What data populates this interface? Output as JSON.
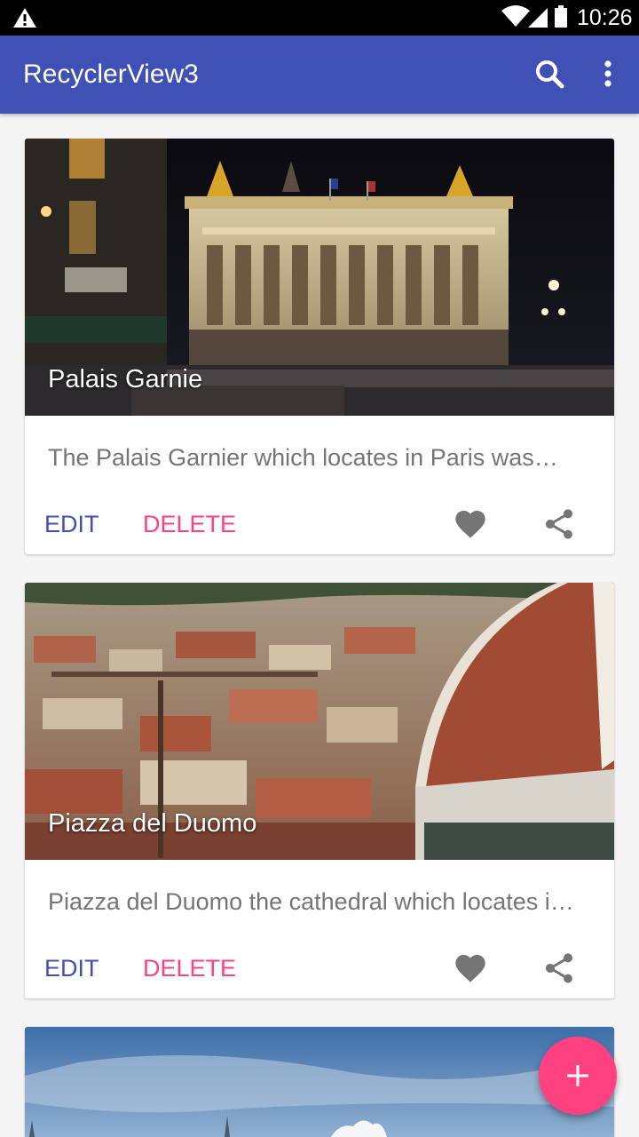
{
  "status_bar": {
    "time": "10:26",
    "icons": [
      "warning-icon",
      "wifi-icon",
      "signal-icon",
      "battery-icon"
    ]
  },
  "app_bar": {
    "title": "RecyclerView3",
    "actions": [
      "search-icon",
      "more-vert-icon"
    ],
    "color": "#3f51b5"
  },
  "cards": [
    {
      "title": "Palais Garnie",
      "description": "The Palais Garnier which locates in Paris was…",
      "edit_label": "EDIT",
      "delete_label": "DELETE",
      "actions": [
        "favorite-icon",
        "share-icon"
      ]
    },
    {
      "title": "Piazza del Duomo",
      "description": "Piazza del Duomo the cathedral which locates i…",
      "edit_label": "EDIT",
      "delete_label": "DELETE",
      "actions": [
        "favorite-icon",
        "share-icon"
      ]
    },
    {
      "title": "",
      "description": "",
      "edit_label": "",
      "delete_label": "",
      "actions": []
    }
  ],
  "fab": {
    "icon": "add-icon",
    "color": "#ff4081"
  },
  "colors": {
    "primary": "#3f51b5",
    "accent": "#ff4081",
    "icon_gray": "#757575"
  }
}
